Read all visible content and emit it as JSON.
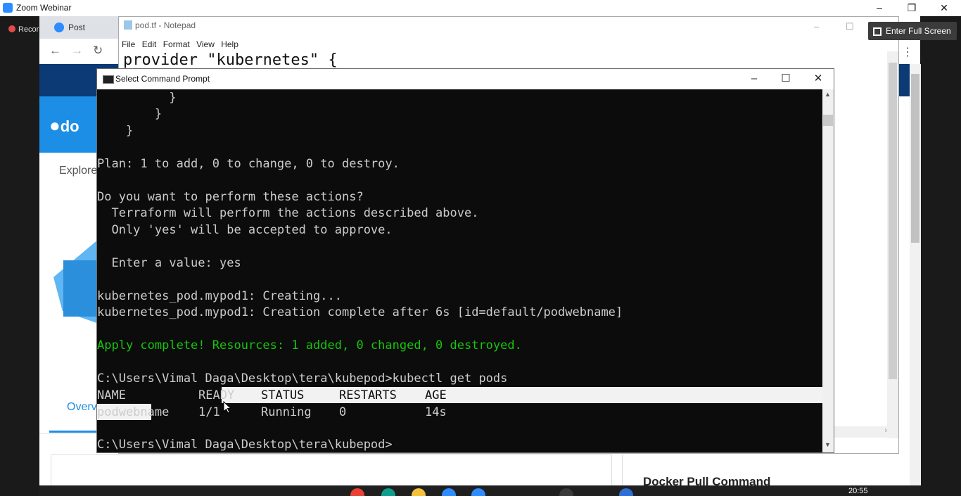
{
  "zoom": {
    "title": "Zoom Webinar",
    "recording_label": "Recording",
    "fullscreen_label": "Enter Full Screen"
  },
  "browser": {
    "tab_label": "Post Attendee",
    "hub_logo": "do",
    "explore_label": "Explore",
    "overview_label": "Overview",
    "pull_command_label": "Docker Pull Command"
  },
  "notepad": {
    "title": "pod.tf - Notepad",
    "menu": [
      "File",
      "Edit",
      "Format",
      "View",
      "Help"
    ],
    "first_line": "provider \"kubernetes\" {"
  },
  "cmd": {
    "title": "Select Command Prompt",
    "lines": [
      "          }",
      "        }",
      "    }",
      "",
      "Plan: 1 to add, 0 to change, 0 to destroy.",
      "",
      "Do you want to perform these actions?",
      "  Terraform will perform the actions described above.",
      "  Only 'yes' will be accepted to approve.",
      "",
      "  Enter a value: yes",
      "",
      "kubernetes_pod.mypod1: Creating...",
      "kubernetes_pod.mypod1: Creation complete after 6s [id=default/podwebname]",
      "",
      "Apply complete! Resources: 1 added, 0 changed, 0 destroyed.",
      "",
      "C:\\Users\\Vimal Daga\\Desktop\\tera\\kubepod>kubectl get pods"
    ],
    "table_header": [
      "NAME",
      "READY",
      "STATUS",
      "RESTARTS",
      "AGE"
    ],
    "table_row": [
      "podwebname",
      "1/1",
      "Running",
      "0",
      "14s"
    ],
    "prompt": "C:\\Users\\Vimal Daga\\Desktop\\tera\\kubepod>"
  },
  "taskbar": {
    "clock": "20:55"
  },
  "colors": {
    "cmd_green": "#16c60c",
    "docker_blue": "#1d8ee5",
    "hub_dark": "#0b3a74"
  }
}
